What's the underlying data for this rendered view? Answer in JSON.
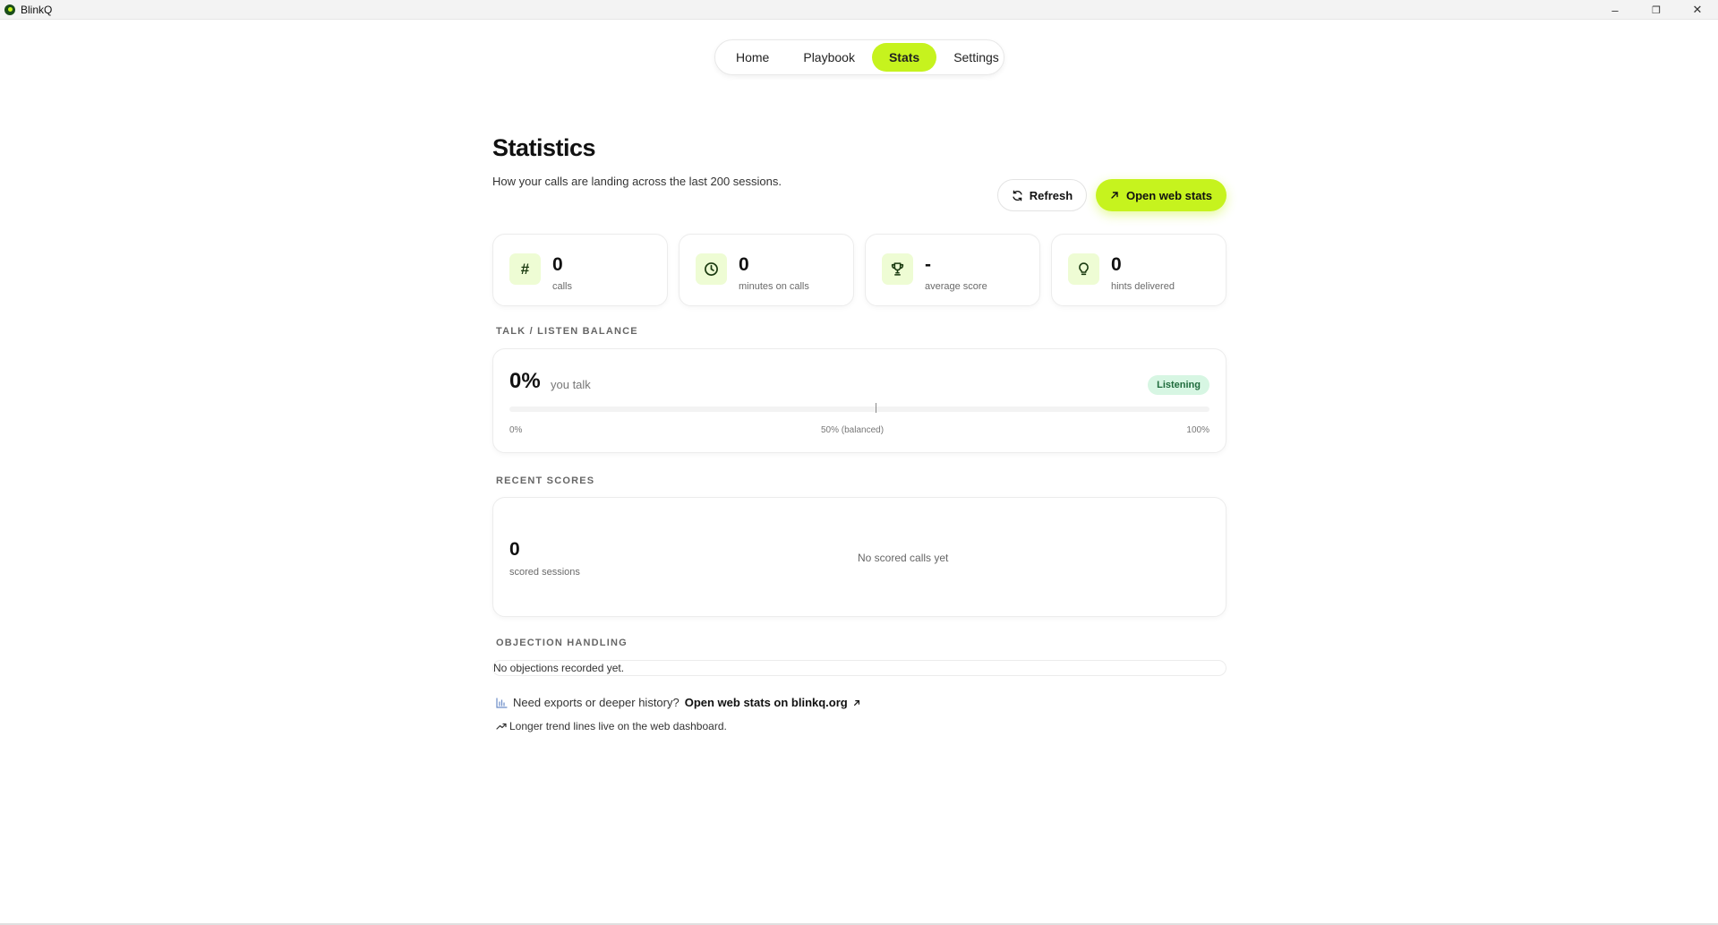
{
  "window": {
    "title": "BlinkQ",
    "controls": {
      "minimize": "–",
      "maximize": "❐",
      "close": "✕"
    }
  },
  "nav": {
    "tabs": [
      {
        "label": "Home",
        "active": false
      },
      {
        "label": "Playbook",
        "active": false
      },
      {
        "label": "Stats",
        "active": true
      },
      {
        "label": "Settings",
        "active": false
      }
    ]
  },
  "header": {
    "title": "Statistics",
    "subtitle": "How your calls are landing across the last 200 sessions.",
    "refresh_label": "Refresh",
    "open_web_label": "Open web stats"
  },
  "stats": [
    {
      "icon": "hash-icon",
      "value": "0",
      "label": "calls"
    },
    {
      "icon": "clock-icon",
      "value": "0",
      "label": "minutes on calls"
    },
    {
      "icon": "trophy-icon",
      "value": "-",
      "label": "average score"
    },
    {
      "icon": "lightbulb-icon",
      "value": "0",
      "label": "hints delivered"
    }
  ],
  "talk_listen": {
    "section_title": "TALK / LISTEN BALANCE",
    "value": "0%",
    "value_label": "you talk",
    "badge": "Listening",
    "talk_fraction": 0,
    "scale_min": "0%",
    "scale_mid": "50% (balanced)",
    "scale_max": "100%"
  },
  "recent_scores": {
    "section_title": "RECENT SCORES",
    "value": "0",
    "label": "scored sessions",
    "empty_message": "No scored calls yet"
  },
  "objections": {
    "section_title": "OBJECTION HANDLING",
    "empty_message": "No objections recorded yet."
  },
  "footer": {
    "prompt": "Need exports or deeper history?",
    "link_label": "Open web stats on blinkq.org",
    "note": "Longer trend lines live on the web dashboard."
  },
  "colors": {
    "accent": "#c6f31e",
    "icon_bg": "#eefcd4",
    "badge_bg": "#d7f6e3",
    "badge_text": "#1f6b3c"
  }
}
